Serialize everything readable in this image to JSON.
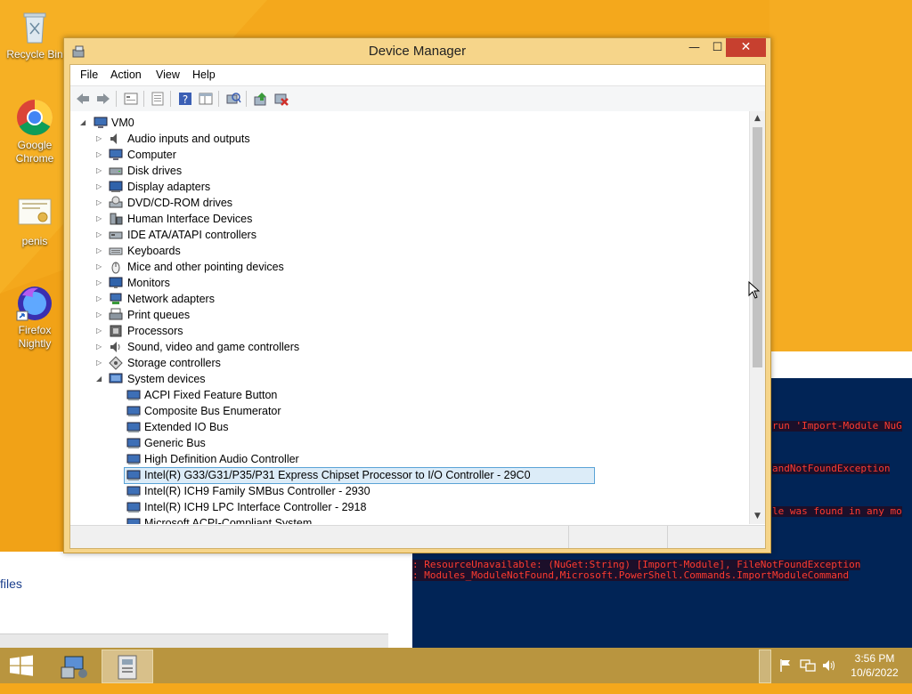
{
  "desktop": {
    "icons": [
      {
        "label": "Recycle Bin",
        "icon": "recycle-bin-icon"
      },
      {
        "label": "Google Chrome",
        "icon": "chrome-icon"
      },
      {
        "label": "penis",
        "icon": "certificate-file-icon"
      },
      {
        "label": "Firefox Nightly",
        "icon": "firefox-nightly-icon"
      }
    ]
  },
  "powershell": {
    "lines": [
      "run 'Import-Module NuG",
      "andNotFoundException",
      "le was found in any mo",
      ": ResourceUnavailable: (NuGet:String) [Import-Module], FileNotFoundException",
      ": Modules_ModuleNotFound,Microsoft.PowerShell.Commands.ImportModuleCommand"
    ]
  },
  "explorer": {
    "files_label": "files"
  },
  "window": {
    "title": "Device Manager",
    "minimize": "—",
    "maximize": "☐",
    "close": "✕"
  },
  "menu": {
    "file": "File",
    "action": "Action",
    "view": "View",
    "help": "Help"
  },
  "toolbar": [
    "back-arrow-icon",
    "forward-arrow-icon",
    "properties-view-icon",
    "show-hidden-icon",
    "help-icon",
    "grid-view-icon",
    "scan-hardware-icon",
    "update-driver-icon",
    "uninstall-device-icon"
  ],
  "tree": {
    "root": "VM0",
    "categories": [
      {
        "label": "Audio inputs and outputs",
        "icon": "speaker-icon"
      },
      {
        "label": "Computer",
        "icon": "computer-icon"
      },
      {
        "label": "Disk drives",
        "icon": "disk-drive-icon"
      },
      {
        "label": "Display adapters",
        "icon": "display-adapter-icon"
      },
      {
        "label": "DVD/CD-ROM drives",
        "icon": "dvd-drive-icon"
      },
      {
        "label": "Human Interface Devices",
        "icon": "hid-icon"
      },
      {
        "label": "IDE ATA/ATAPI controllers",
        "icon": "ide-controller-icon"
      },
      {
        "label": "Keyboards",
        "icon": "keyboard-icon"
      },
      {
        "label": "Mice and other pointing devices",
        "icon": "mouse-icon"
      },
      {
        "label": "Monitors",
        "icon": "monitor-icon"
      },
      {
        "label": "Network adapters",
        "icon": "network-adapter-icon"
      },
      {
        "label": "Print queues",
        "icon": "printer-icon"
      },
      {
        "label": "Processors",
        "icon": "processor-icon"
      },
      {
        "label": "Sound, video and game controllers",
        "icon": "sound-controller-icon"
      },
      {
        "label": "Storage controllers",
        "icon": "storage-controller-icon"
      },
      {
        "label": "System devices",
        "icon": "system-device-icon"
      }
    ],
    "system_devices": [
      "ACPI Fixed Feature Button",
      "Composite Bus Enumerator",
      "Extended IO Bus",
      "Generic Bus",
      "High Definition Audio Controller",
      "Intel(R) G33/G31/P35/P31 Express Chipset Processor to I/O Controller - 29C0",
      "Intel(R) ICH9 Family SMBus Controller - 2930",
      "Intel(R) ICH9 LPC Interface Controller - 2918",
      "Microsoft ACPI-Compliant System"
    ],
    "selected_index": 5
  },
  "taskbar": {
    "items": [
      "start-icon",
      "device-manager-task-icon",
      "vm-app-task-icon"
    ],
    "tray_icons": [
      "flag-icon",
      "network-icon",
      "volume-icon"
    ],
    "time": "3:56 PM",
    "date": "10/6/2022"
  },
  "colors": {
    "desktop": "#f4a81c",
    "titlebar": "#f6d58a",
    "close": "#c7402f",
    "selection_border": "#5aa3d6",
    "powershell": "#012456",
    "taskbar": "#b9953f"
  }
}
